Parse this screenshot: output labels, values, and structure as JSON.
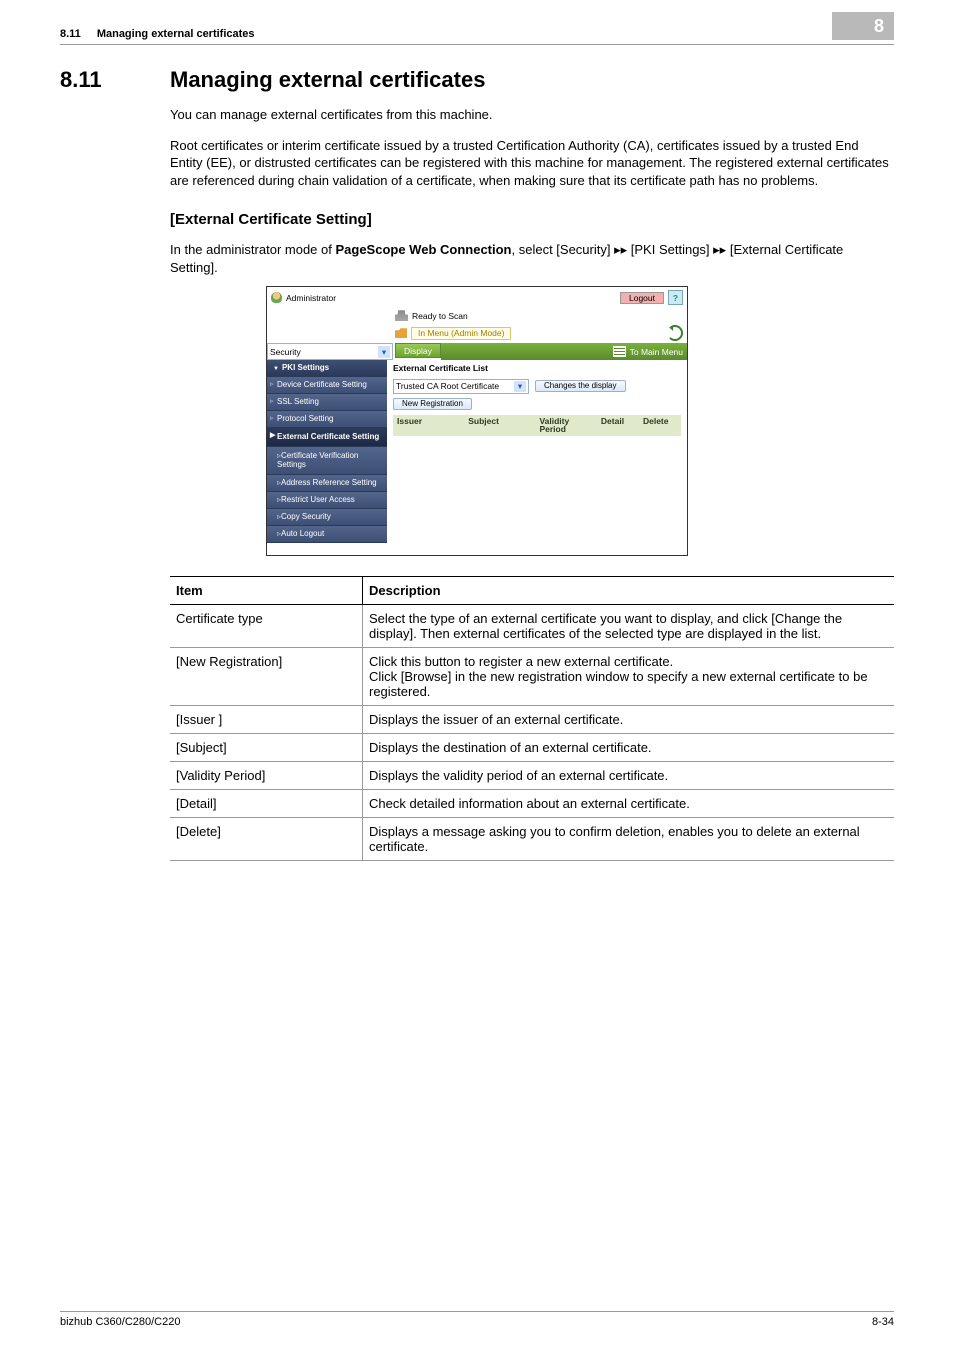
{
  "header": {
    "section_number": "8.11",
    "section_title_short": "Managing external certificates",
    "chapter_number": "8"
  },
  "section": {
    "number": "8.11",
    "title": "Managing external certificates"
  },
  "paragraphs": {
    "intro": "You can manage external certificates from this machine.",
    "detail": "Root certificates or interim certificate issued by a trusted Certification Authority (CA), certificates issued by a trusted End Entity (EE), or distrusted certificates can be registered with this machine for management. The registered external certificates are referenced during chain validation of a certificate, when making sure that its certificate path has no problems."
  },
  "subheading": "[External Certificate Setting]",
  "path_sentence": {
    "prefix": "In the administrator mode of ",
    "product": "PageScope Web Connection",
    "middle1": ", select [Security] ",
    "arrow": "▸▸",
    "seg2": " [PKI Settings] ",
    "seg3": " [External Certificate Setting]."
  },
  "app": {
    "role": "Administrator",
    "logout": "Logout",
    "help": "?",
    "ready": "Ready to Scan",
    "mode": "In Menu (Admin Mode)",
    "category": "Security",
    "display_btn": "Display",
    "to_main_menu": "To Main Menu",
    "nav": {
      "pki": "PKI Settings",
      "device_cert": "Device Certificate Setting",
      "ssl": "SSL Setting",
      "protocol": "Protocol Setting",
      "ext_cert": "External Certificate Setting",
      "cert_verify": "Certificate Verification Settings",
      "addr_ref": "Address Reference Setting",
      "restrict": "Restrict User Access",
      "copy_sec": "Copy Security",
      "auto_logout": "Auto Logout"
    },
    "pane": {
      "title": "External Certificate List",
      "type_selected": "Trusted CA Root Certificate",
      "changes_display": "Changes the display",
      "new_reg": "New Registration",
      "cols": {
        "issuer": "Issuer",
        "subject": "Subject",
        "validity": "Validity Period",
        "detail": "Detail",
        "delete": "Delete"
      }
    }
  },
  "table": {
    "head_item": "Item",
    "head_desc": "Description",
    "rows": [
      {
        "item": "Certificate type",
        "desc": "Select the type of an external certificate you want to display, and click [Change the display]. Then external certificates of the selected type are displayed in the list."
      },
      {
        "item": "[New Registration]",
        "desc": "Click this button to register a new external certificate.\nClick [Browse] in the new registration window to specify a new external certificate to be registered."
      },
      {
        "item": "[Issuer ]",
        "desc": "Displays the issuer of an external certificate."
      },
      {
        "item": "[Subject]",
        "desc": "Displays the destination of an external certificate."
      },
      {
        "item": "[Validity Period]",
        "desc": "Displays the validity period of an external certificate."
      },
      {
        "item": "[Detail]",
        "desc": "Check detailed information about an external certificate."
      },
      {
        "item": "[Delete]",
        "desc": "Displays a message asking you to confirm deletion, enables you to delete an external certificate."
      }
    ]
  },
  "footer": {
    "model": "bizhub C360/C280/C220",
    "page": "8-34"
  }
}
